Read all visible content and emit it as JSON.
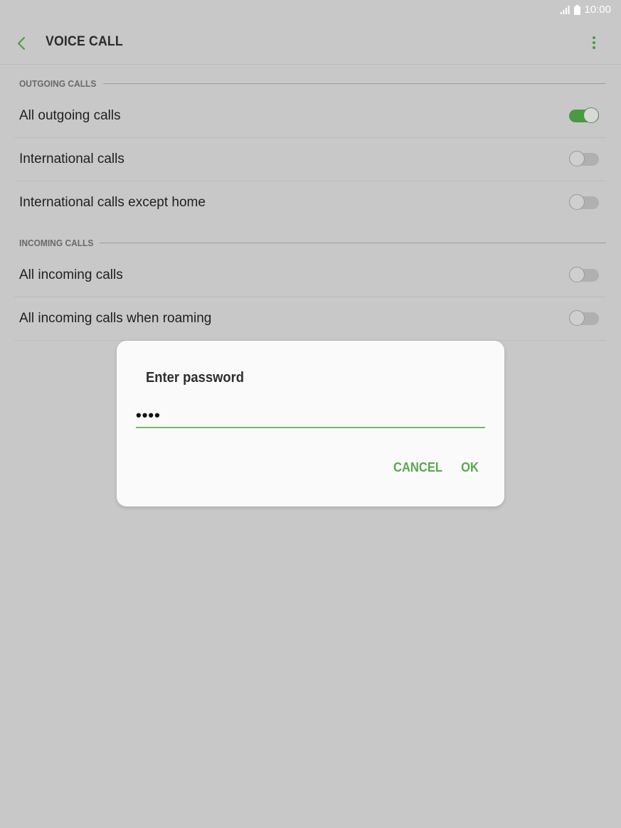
{
  "status_bar": {
    "time": "10:00"
  },
  "app_bar": {
    "title": "VOICE CALL"
  },
  "outgoing": {
    "header": "OUTGOING CALLS",
    "items": [
      {
        "label": "All outgoing calls",
        "enabled": true
      },
      {
        "label": "International calls",
        "enabled": false
      },
      {
        "label": "International calls except home",
        "enabled": false
      }
    ]
  },
  "incoming": {
    "header": "INCOMING CALLS",
    "items": [
      {
        "label": "All incoming calls",
        "enabled": false
      },
      {
        "label": "All incoming calls when roaming",
        "enabled": false
      }
    ]
  },
  "dialog": {
    "title": "Enter password",
    "password_value": "••••",
    "cancel_label": "CANCEL",
    "ok_label": "OK"
  },
  "colors": {
    "accent": "#5aa64f",
    "switch_on": "#4a9a41",
    "background": "#c8c8c8"
  },
  "icons": [
    "back-icon",
    "more-vert-icon",
    "signal-icon",
    "battery-icon"
  ]
}
